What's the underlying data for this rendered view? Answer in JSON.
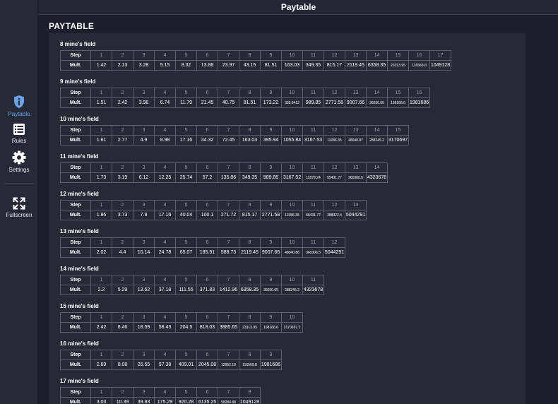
{
  "header": {
    "title": "Paytable"
  },
  "sidebar": {
    "items": [
      {
        "label": "Paytable",
        "icon": "info-shield-icon",
        "active": true
      },
      {
        "label": "Rules",
        "icon": "list-icon"
      },
      {
        "label": "Settings",
        "icon": "gear-icon"
      },
      {
        "label": "Fullscreen",
        "icon": "fullscreen-icon"
      }
    ]
  },
  "colors": {
    "accent": "#6aa4e6",
    "background": "#1b1f29",
    "panel": "#252a35",
    "border": "#5a6070"
  },
  "paytable": {
    "title": "PAYTABLE",
    "step_label": "Step",
    "mult_label": "Mult.",
    "fields": [
      {
        "title": "8 mine's field",
        "mults": [
          "1.42",
          "2.13",
          "3.28",
          "5.15",
          "8.32",
          "13.88",
          "23.97",
          "43.15",
          "81.51",
          "163.03",
          "349.35",
          "815.17",
          "2119.45",
          "6358.35",
          "23313.95",
          "116569.8",
          "1049128"
        ]
      },
      {
        "title": "9 mine's field",
        "mults": [
          "1.51",
          "2.42",
          "3.98",
          "6.74",
          "11.79",
          "21.45",
          "40.75",
          "81.51",
          "173.22",
          "395.9412",
          "989.85",
          "2771.58",
          "9007.66",
          "36030.65",
          "198168.6",
          "1981686"
        ]
      },
      {
        "title": "10 mine's field",
        "mults": [
          "1.61",
          "2.77",
          "4.9",
          "8.98",
          "17.16",
          "34.32",
          "72.45",
          "163.03",
          "395.94",
          "1055.84",
          "3167.53",
          "11086.35",
          "48040.87",
          "288245.2",
          "3170697"
        ]
      },
      {
        "title": "11 mine's field",
        "mults": [
          "1.73",
          "3.19",
          "6.12",
          "12.25",
          "25.74",
          "57.2",
          "135.86",
          "349.35",
          "989.85",
          "3167.52",
          "11878.24",
          "55431.77",
          "360306.5",
          "4323678"
        ]
      },
      {
        "title": "12 mine's field",
        "mults": [
          "1.86",
          "3.73",
          "7.8",
          "17.16",
          "40.04",
          "100.1",
          "271.72",
          "815.17",
          "2771.58",
          "11086.35",
          "55431.77",
          "388022.4",
          "5044291"
        ]
      },
      {
        "title": "13 mine's field",
        "mults": [
          "2.02",
          "4.4",
          "10.14",
          "24.78",
          "65.07",
          "185.91",
          "588.73",
          "2119.45",
          "9007.66",
          "48040.86",
          "360306.5",
          "5044291"
        ]
      },
      {
        "title": "14 mine's field",
        "mults": [
          "2.2",
          "5.29",
          "13.52",
          "37.18",
          "111.55",
          "371.83",
          "1412.96",
          "6358.35",
          "36030.65",
          "288245.2",
          "4323678"
        ]
      },
      {
        "title": "15 mine's field",
        "mults": [
          "2.42",
          "6.46",
          "18.59",
          "58.43",
          "204.5",
          "818.03",
          "3885.65",
          "23313.95",
          "198168.6",
          "3170697.2"
        ]
      },
      {
        "title": "16 mine's field",
        "mults": [
          "2.69",
          "8.08",
          "26.55",
          "97.38",
          "409.01",
          "2045.08",
          "12952.19",
          "116569.8",
          "1981686"
        ]
      },
      {
        "title": "17 mine's field",
        "mults": [
          "3.03",
          "10.39",
          "39.83",
          "175.29",
          "920.28",
          "6135.25",
          "58284.88",
          "1049128"
        ]
      }
    ]
  }
}
